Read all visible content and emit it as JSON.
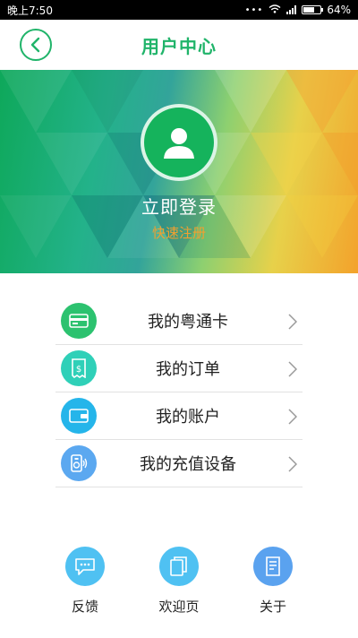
{
  "status_bar": {
    "time": "晚上7:50",
    "battery_percent": "64%",
    "battery_level": 0.64
  },
  "header": {
    "title": "用户中心"
  },
  "profile": {
    "login_label": "立即登录",
    "register_label": "快速注册"
  },
  "menu": {
    "items": [
      {
        "label": "我的粤通卡",
        "icon": "card-icon",
        "color": "#2cc26f"
      },
      {
        "label": "我的订单",
        "icon": "receipt-icon",
        "color": "#2fd0b8"
      },
      {
        "label": "我的账户",
        "icon": "wallet-icon",
        "color": "#25b5ea"
      },
      {
        "label": "我的充值设备",
        "icon": "device-icon",
        "color": "#5ba8f0"
      }
    ]
  },
  "bottom_nav": {
    "items": [
      {
        "label": "反馈",
        "icon": "chat-icon",
        "color": "#4fc1f2"
      },
      {
        "label": "欢迎页",
        "icon": "pages-icon",
        "color": "#4fc1f2"
      },
      {
        "label": "关于",
        "icon": "document-icon",
        "color": "#5aa2ef"
      }
    ]
  },
  "colors": {
    "brand": "#20b46a",
    "accent": "#f0a030"
  }
}
